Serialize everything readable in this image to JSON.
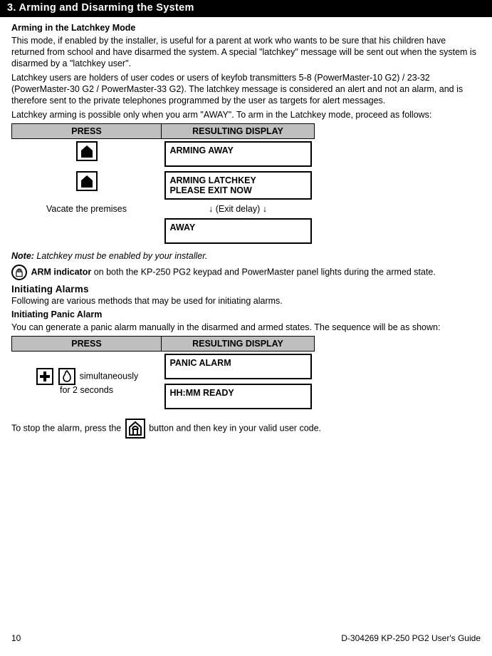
{
  "header": {
    "title": "3. Arming and Disarming the System"
  },
  "latchkey": {
    "heading": "Arming in the Latchkey Mode",
    "p1": "This mode, if enabled by the installer, is useful for a parent at work who wants to be sure that his children have returned from school and have disarmed the system. A special \"latchkey\" message will be sent out when the system is disarmed by a \"latchkey user\".",
    "p2": "Latchkey users are holders of user codes or users of keyfob transmitters 5-8 (PowerMaster-10 G2) / 23-32 (PowerMaster-30 G2 / PowerMaster-33 G2). The latchkey message is considered an alert and not an alarm, and is therefore sent to the private telephones programmed by the user as targets for alert messages.",
    "p3": "Latchkey arming is possible only when you arm \"AWAY\". To arm in the Latchkey mode, proceed as follows:",
    "table": {
      "th_press": "PRESS",
      "th_display": "RESULTING DISPLAY",
      "row1_display": "ARMING AWAY",
      "row2_display_l1": "ARMING LATCHKEY",
      "row2_display_l2": "PLEASE EXIT NOW",
      "row3_press": "Vacate the premises",
      "row3_display": "↓     (Exit delay)     ↓",
      "row4_display": "AWAY"
    },
    "note_label": "Note:",
    "note_text": " Latchkey must be enabled by your installer.",
    "arm_row_b": "ARM indicator",
    "arm_row_t": " on both the KP-250 PG2 keypad and PowerMaster panel lights during the armed state."
  },
  "alarms": {
    "heading": "Initiating Alarms",
    "intro": "Following are various methods that may be used for initiating alarms.",
    "panic_heading": "Initiating Panic Alarm",
    "panic_intro": "You can generate a panic alarm manually in the disarmed and armed states. The sequence will be as shown:",
    "table": {
      "th_press": "PRESS",
      "th_display": "RESULTING DISPLAY",
      "press_l1": " simultaneously",
      "press_l2": "for 2 seconds",
      "disp1": "PANIC ALARM",
      "disp2": "HH:MM       READY"
    },
    "stop_a": "To stop the alarm, press the ",
    "stop_b": " button and then key in your valid user code."
  },
  "footer": {
    "page": "10",
    "doc": "D-304269 KP-250 PG2 User's Guide"
  }
}
